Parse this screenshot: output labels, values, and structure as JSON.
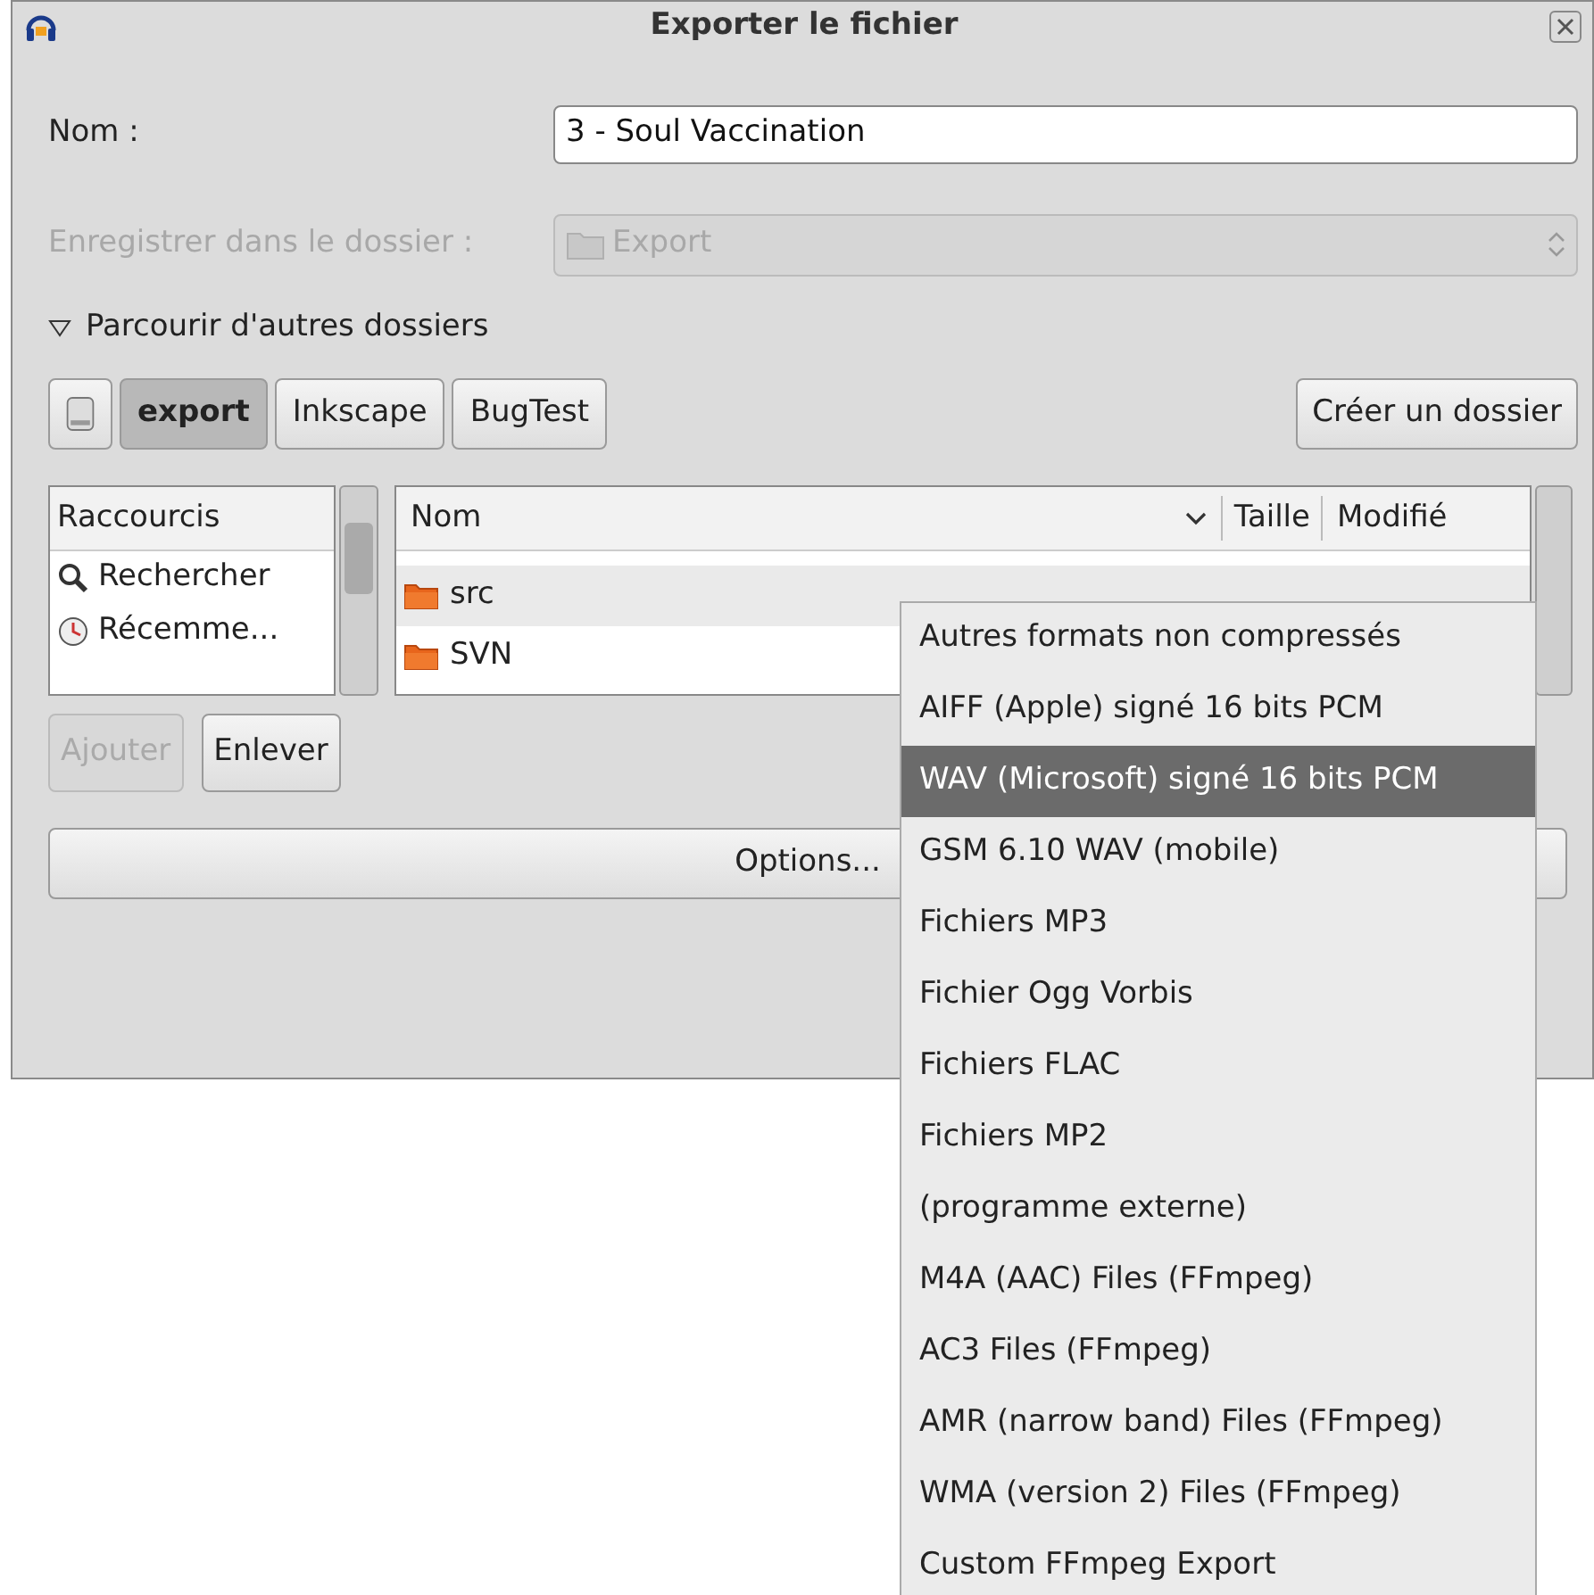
{
  "window": {
    "title": "Exporter le fichier"
  },
  "name_field": {
    "label": "Nom :",
    "value": "3 - Soul Vaccination"
  },
  "folder_field": {
    "label": "Enregistrer dans le dossier :",
    "value": "Export",
    "disabled": true
  },
  "browse_expander": {
    "label": "Parcourir d'autres dossiers",
    "expanded": true
  },
  "path_bar": [
    {
      "label": "export",
      "selected": true
    },
    {
      "label": "Inkscape",
      "selected": false
    },
    {
      "label": "BugTest",
      "selected": false
    }
  ],
  "create_folder_button": "Créer un dossier",
  "shortcuts": {
    "header": "Raccourcis",
    "items": [
      {
        "label": "Rechercher",
        "kind": "search"
      },
      {
        "label": "Récemme...",
        "kind": "recent"
      }
    ]
  },
  "files": {
    "columns": [
      "Nom",
      "Taille",
      "Modifié"
    ],
    "rows": [
      {
        "name": "src"
      },
      {
        "name": "SVN"
      }
    ]
  },
  "shortcut_buttons": [
    {
      "label": "Ajouter",
      "disabled": true
    },
    {
      "label": "Enlever",
      "disabled": false
    }
  ],
  "options_button": "Options...",
  "format_menu": [
    {
      "label": "Autres formats non compressés",
      "selected": false
    },
    {
      "label": "AIFF (Apple) signé 16 bits PCM",
      "selected": false
    },
    {
      "label": "WAV (Microsoft) signé 16 bits PCM",
      "selected": true
    },
    {
      "label": "GSM 6.10 WAV (mobile)",
      "selected": false
    },
    {
      "label": "Fichiers MP3",
      "selected": false
    },
    {
      "label": "Fichier Ogg Vorbis",
      "selected": false
    },
    {
      "label": "Fichiers FLAC",
      "selected": false
    },
    {
      "label": "Fichiers MP2",
      "selected": false
    },
    {
      "label": "(programme externe)",
      "selected": false
    },
    {
      "label": "M4A (AAC) Files (FFmpeg)",
      "selected": false
    },
    {
      "label": "AC3 Files (FFmpeg)",
      "selected": false
    },
    {
      "label": "AMR (narrow band) Files (FFmpeg)",
      "selected": false
    },
    {
      "label": "WMA (version 2) Files (FFmpeg)",
      "selected": false
    },
    {
      "label": "Custom FFmpeg Export",
      "selected": false
    }
  ]
}
